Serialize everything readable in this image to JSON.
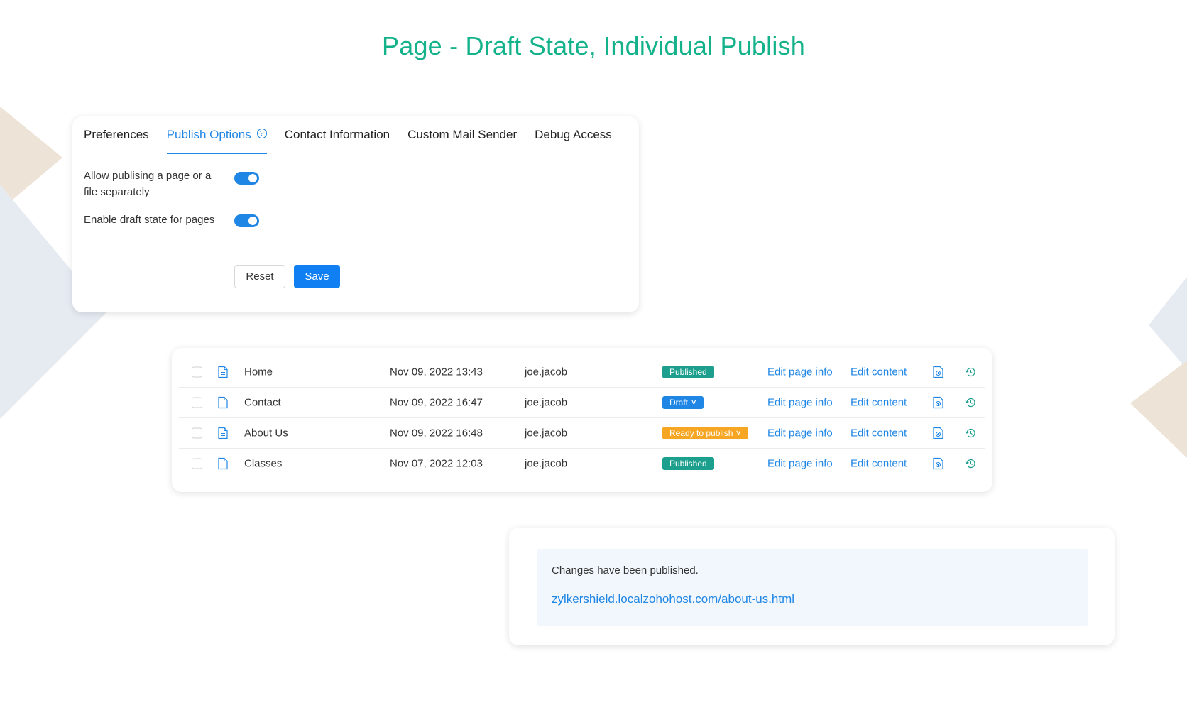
{
  "title": "Page - Draft State, Individual Publish",
  "colors": {
    "accent": "#1f86e5",
    "title": "#14b28a",
    "published": "#1c9f8c",
    "draft": "#1f86e5",
    "ready": "#f6a623"
  },
  "settings": {
    "tabs": [
      {
        "label": "Preferences",
        "active": false
      },
      {
        "label": "Publish Options",
        "active": true
      },
      {
        "label": "Contact Information",
        "active": false
      },
      {
        "label": "Custom Mail Sender",
        "active": false
      },
      {
        "label": "Debug Access",
        "active": false
      }
    ],
    "options": [
      {
        "label": "Allow publising a page or a file separately",
        "enabled": true
      },
      {
        "label": "Enable draft state for pages",
        "enabled": true
      }
    ],
    "reset_label": "Reset",
    "save_label": "Save"
  },
  "pages": [
    {
      "name": "Home",
      "date": "Nov 09, 2022 13:43",
      "user": "joe.jacob",
      "status": "Published",
      "edit_info": "Edit page info",
      "edit_content": "Edit content"
    },
    {
      "name": "Contact",
      "date": "Nov 09, 2022 16:47",
      "user": "joe.jacob",
      "status": "Draft",
      "edit_info": "Edit page info",
      "edit_content": "Edit content"
    },
    {
      "name": "About Us",
      "date": "Nov 09, 2022 16:48",
      "user": "joe.jacob",
      "status": "Ready to publish",
      "edit_info": "Edit page info",
      "edit_content": "Edit content"
    },
    {
      "name": "Classes",
      "date": "Nov 07, 2022 12:03",
      "user": "joe.jacob",
      "status": "Published",
      "edit_info": "Edit page info",
      "edit_content": "Edit content"
    }
  ],
  "notice": {
    "message": "Changes have been published.",
    "url": "zylkershield.localzohohost.com/about-us.html"
  }
}
